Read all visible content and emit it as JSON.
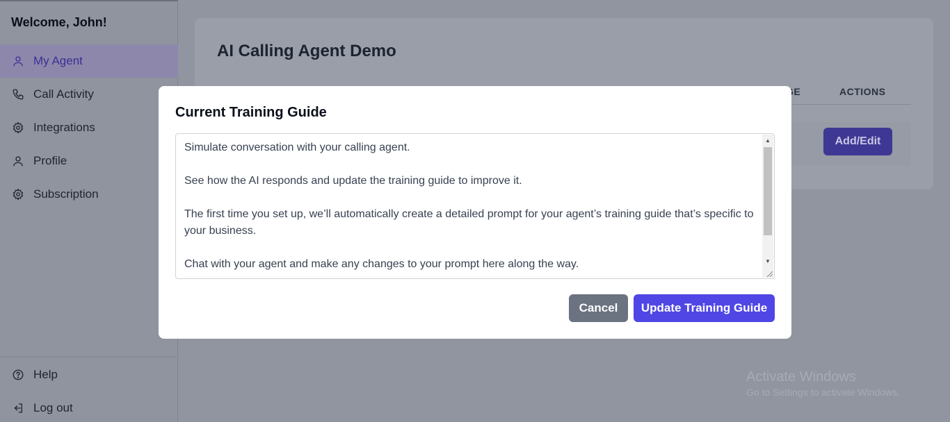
{
  "sidebar": {
    "welcome": "Welcome, John!",
    "items": [
      {
        "label": "My Agent",
        "icon": "user-icon",
        "active": true
      },
      {
        "label": "Call Activity",
        "icon": "phone-icon"
      },
      {
        "label": "Integrations",
        "icon": "gear-icon"
      },
      {
        "label": "Profile",
        "icon": "user-icon"
      },
      {
        "label": "Subscription",
        "icon": "gear-icon"
      }
    ],
    "bottom_items": [
      {
        "label": "Help",
        "icon": "help-circle-icon"
      },
      {
        "label": "Log out",
        "icon": "logout-icon"
      }
    ]
  },
  "main": {
    "title": "AI Calling Agent Demo",
    "columns": [
      "GE",
      "ACTIONS"
    ],
    "row_action_label": "Add/Edit"
  },
  "modal": {
    "title": "Current Training Guide",
    "guide_text": "Simulate conversation with your calling agent.\n\nSee how the AI responds and update the training guide to improve it.\n\nThe first time you set up, we’ll automatically create a detailed prompt for your agent’s training guide that’s specific to your business.\n\nChat with your agent and make any changes to your prompt here along the way.",
    "cancel_label": "Cancel",
    "update_label": "Update Training Guide"
  },
  "watermark": {
    "line1": "Activate Windows",
    "line2": "Go to Settings to activate Windows."
  },
  "colors": {
    "accent": "#4f46e5",
    "cancel": "#6b7280",
    "overlay_sidebar_active": "#8d88ab"
  }
}
